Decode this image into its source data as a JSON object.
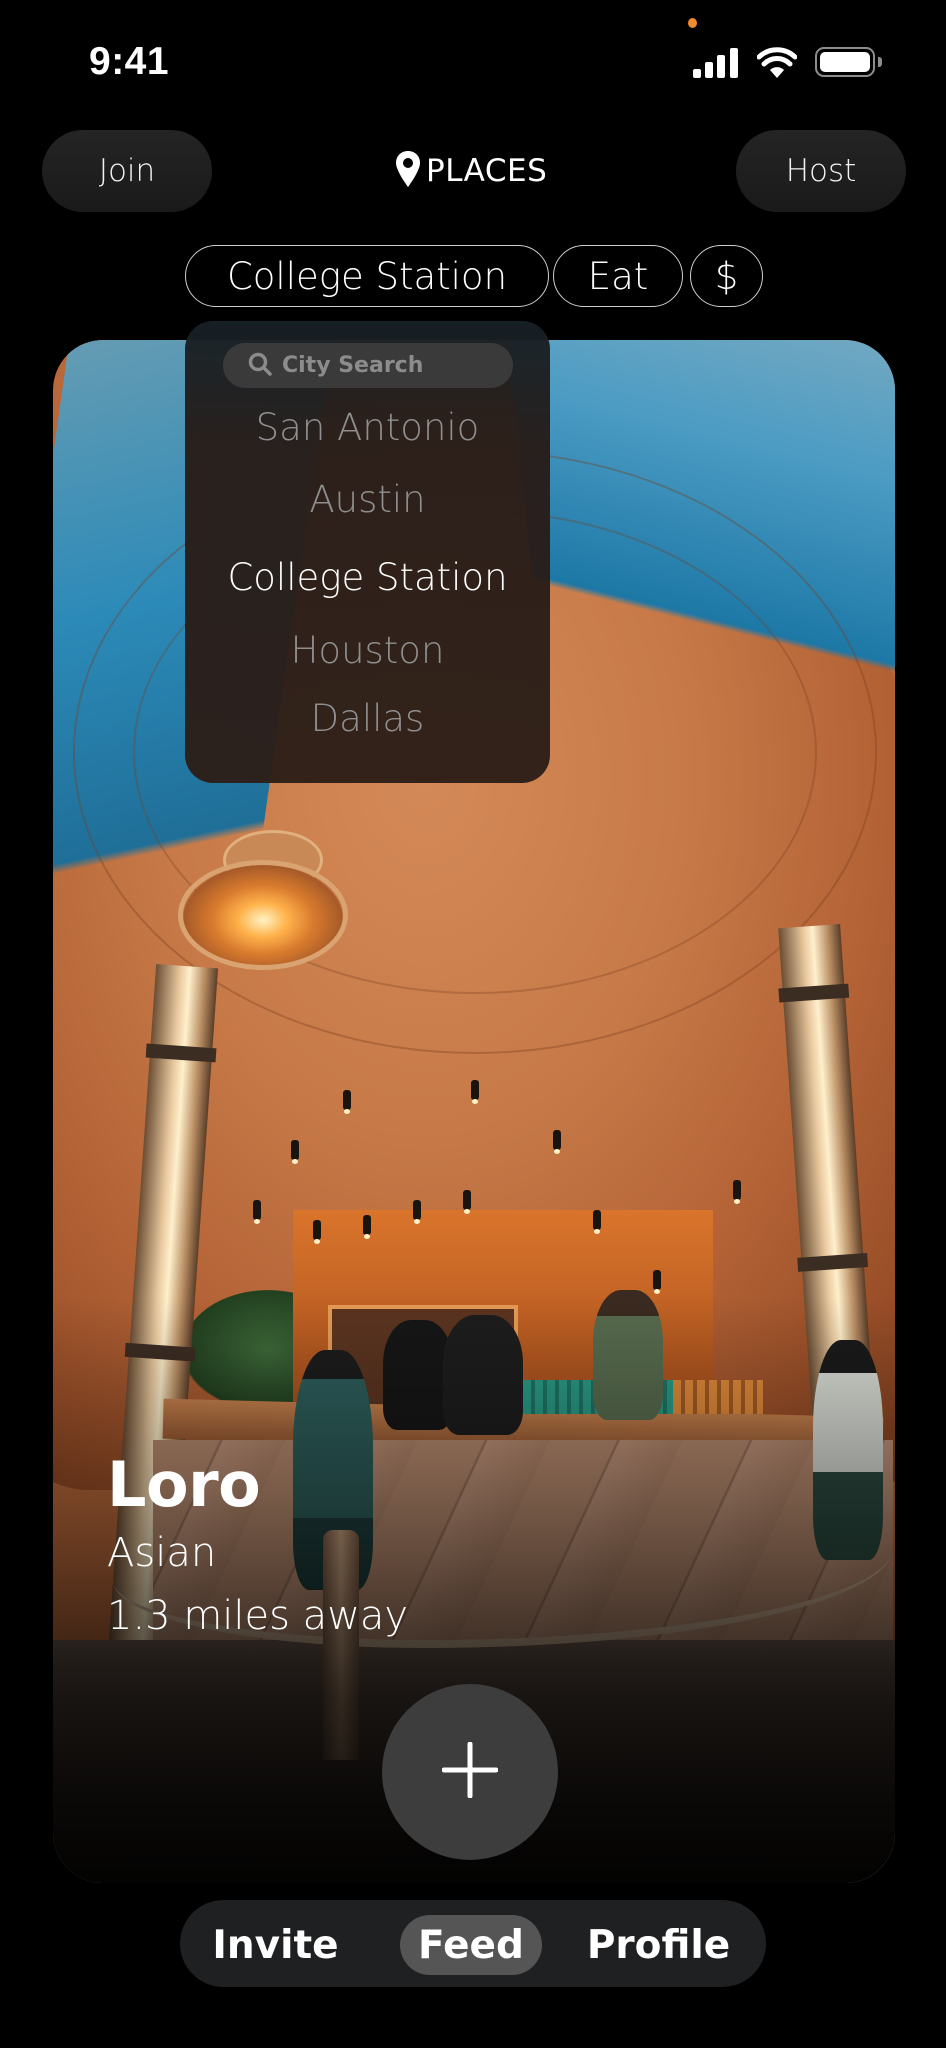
{
  "status_bar": {
    "time": "9:41",
    "privacy_indicator_color": "#f08a2c",
    "icons": [
      "cellular-signal-icon",
      "wifi-icon",
      "battery-icon"
    ]
  },
  "header": {
    "left_button": "Join",
    "right_button": "Host",
    "title": "PLACES",
    "title_icon": "location-pin-icon"
  },
  "filters": {
    "city": "College Station",
    "category": "Eat",
    "price": "$"
  },
  "city_dropdown": {
    "search_placeholder": "City Search",
    "search_icon": "search-icon",
    "cities": [
      {
        "label": "San Antonio",
        "selected": false
      },
      {
        "label": "Austin",
        "selected": false
      },
      {
        "label": "College Station",
        "selected": true
      },
      {
        "label": "Houston",
        "selected": false
      },
      {
        "label": "Dallas",
        "selected": false
      }
    ]
  },
  "place": {
    "name": "Loro",
    "cuisine": "Asian",
    "distance": "1.3 miles away"
  },
  "add_button": {
    "icon": "plus-icon"
  },
  "bottom_nav": {
    "items": [
      {
        "label": "Invite",
        "active": false
      },
      {
        "label": "Feed",
        "active": true
      },
      {
        "label": "Profile",
        "active": false
      }
    ]
  },
  "colors": {
    "background": "#000000",
    "button_fill": "#1f1f1f",
    "nav_fill": "#1f2022",
    "nav_active": "#555555",
    "add_button_fill": "#3d3d3d",
    "dropdown_dim_text": "#8f8f8f"
  }
}
